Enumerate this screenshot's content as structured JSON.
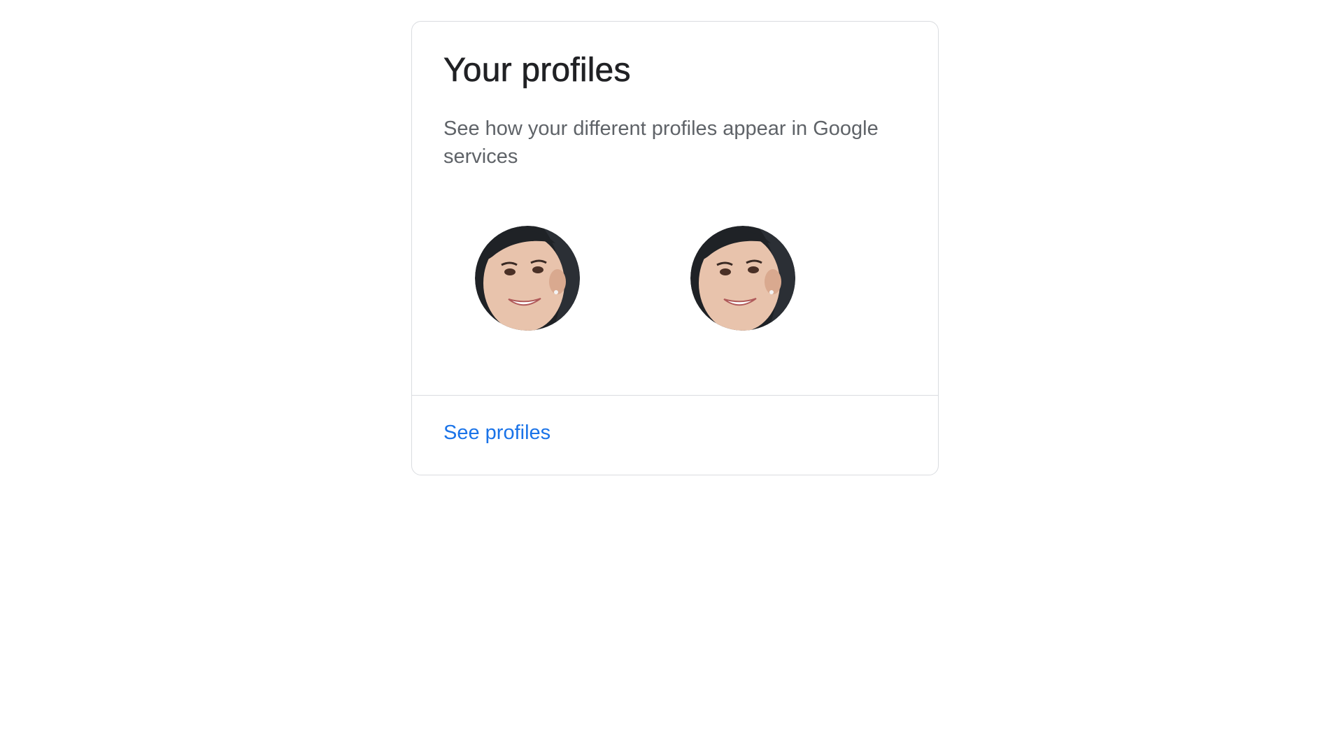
{
  "card": {
    "title": "Your profiles",
    "subtitle": "See how your different profiles appear in Google services",
    "profiles": [
      {
        "icon": "profile-photo"
      },
      {
        "icon": "profile-photo"
      }
    ],
    "link_label": "See profiles"
  },
  "colors": {
    "title": "#202124",
    "subtitle": "#5f6368",
    "link": "#1a73e8",
    "border": "#dadce0"
  }
}
